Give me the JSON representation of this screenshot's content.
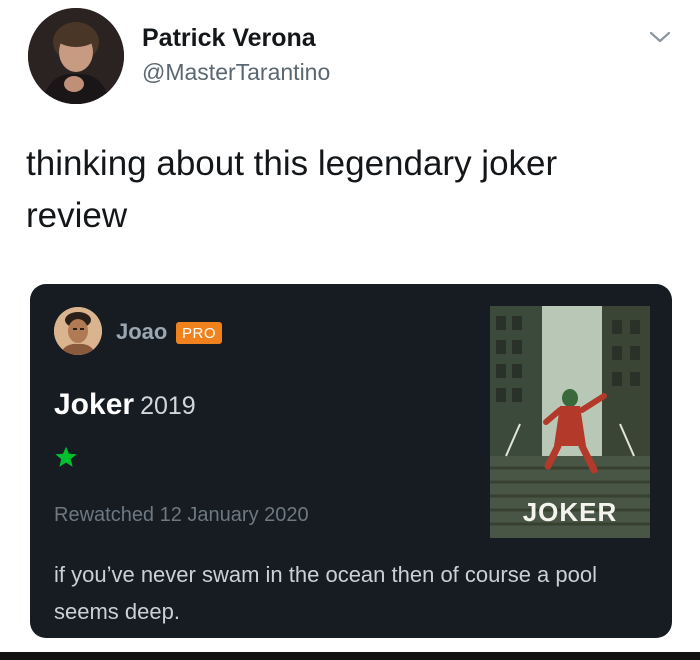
{
  "tweet": {
    "display_name": "Patrick Verona",
    "handle": "@MasterTarantino",
    "text": "thinking about this legendary joker review",
    "avatar_icon": "user-avatar",
    "menu_icon": "chevron-down-icon"
  },
  "review_card": {
    "reviewer_name": "Joao",
    "badge": "PRO",
    "film_title": "Joker",
    "film_year": "2019",
    "rating_stars": 1,
    "rewatch_text": "Rewatched 12 January 2020",
    "review_text": "if you’ve never swam in the ocean then of course a pool seems deep.",
    "poster_title": "JOKER",
    "colors": {
      "card_background": "#161c21",
      "star": "#00c030",
      "badge": "#f0821e"
    }
  }
}
